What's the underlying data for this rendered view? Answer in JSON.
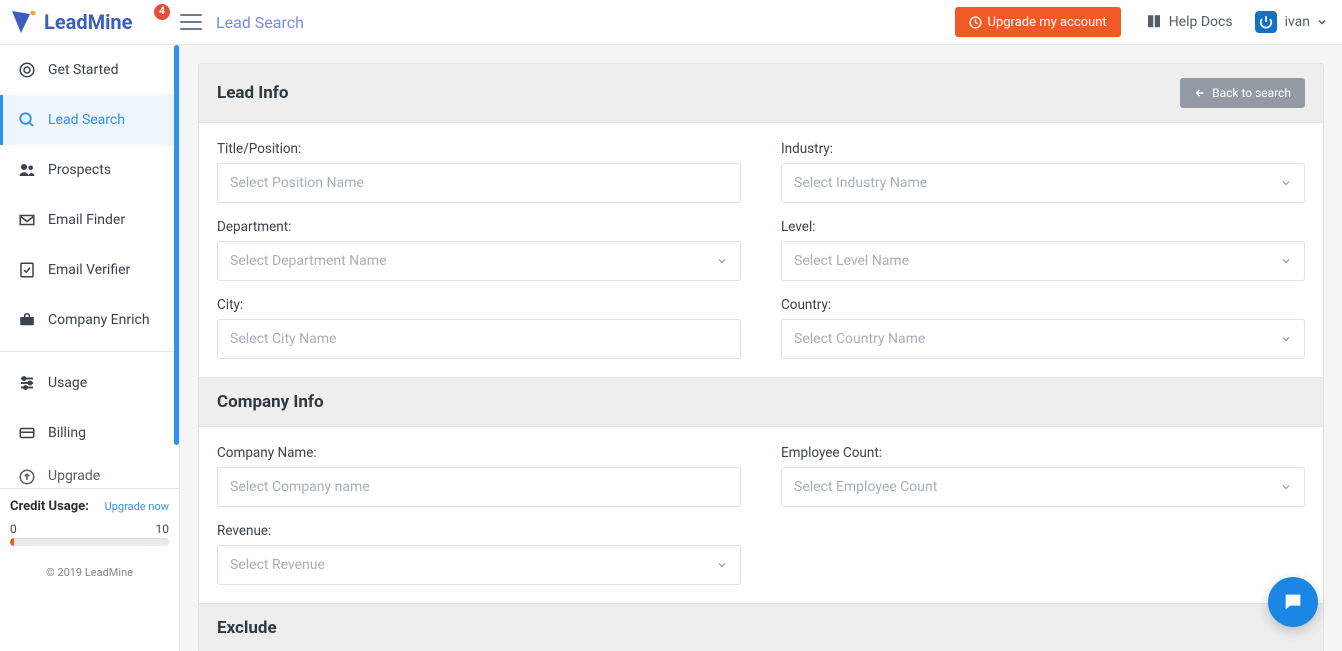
{
  "brand": {
    "lead": "Lead",
    "mine": "Mine",
    "badge": "4"
  },
  "header": {
    "crumb": "Lead Search",
    "upgrade": "Upgrade my account",
    "help": "Help Docs",
    "user": "ivan"
  },
  "sidebar": {
    "items": [
      {
        "label": "Get Started"
      },
      {
        "label": "Lead Search"
      },
      {
        "label": "Prospects"
      },
      {
        "label": "Email Finder"
      },
      {
        "label": "Email Verifier"
      },
      {
        "label": "Company Enrich"
      }
    ],
    "items2": [
      {
        "label": "Usage"
      },
      {
        "label": "Billing"
      },
      {
        "label": "Upgrade"
      }
    ],
    "credit_title": "Credit Usage:",
    "credit_link": "Upgrade now",
    "credit_min": "0",
    "credit_max": "10",
    "copyright": "© 2019 LeadMine"
  },
  "form": {
    "lead_info_title": "Lead Info",
    "back_btn": "Back to search",
    "company_info_title": "Company Info",
    "exclude_title": "Exclude",
    "fields": {
      "title_label": "Title/Position:",
      "title_ph": "Select Position Name",
      "industry_label": "Industry:",
      "industry_ph": "Select Industry Name",
      "department_label": "Department:",
      "department_ph": "Select Department Name",
      "level_label": "Level:",
      "level_ph": "Select Level Name",
      "city_label": "City:",
      "city_ph": "Select City Name",
      "country_label": "Country:",
      "country_ph": "Select Country Name",
      "company_label": "Company Name:",
      "company_ph": "Select Company name",
      "employee_label": "Employee Count:",
      "employee_ph": "Select Employee Count",
      "revenue_label": "Revenue:",
      "revenue_ph": "Select Revenue"
    }
  }
}
